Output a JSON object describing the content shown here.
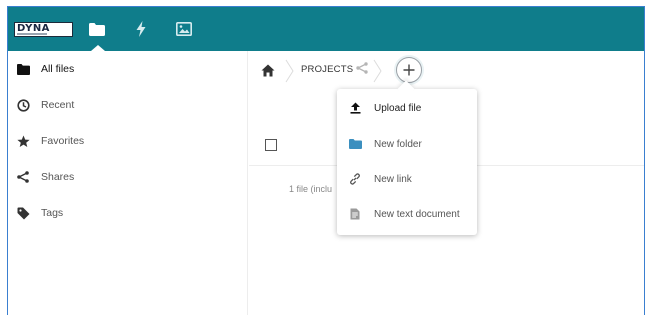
{
  "header": {
    "logo_text": "DYNA",
    "apps": [
      {
        "name": "files",
        "icon": "folder-icon",
        "active": true
      },
      {
        "name": "activity",
        "icon": "lightning-icon",
        "active": false
      },
      {
        "name": "gallery",
        "icon": "image-icon",
        "active": false
      }
    ],
    "bar_color": "#0f7d8b"
  },
  "sidebar": {
    "items": [
      {
        "label": "All files",
        "icon": "folder-icon",
        "active": true
      },
      {
        "label": "Recent",
        "icon": "clock-icon",
        "active": false
      },
      {
        "label": "Favorites",
        "icon": "star-icon",
        "active": false
      },
      {
        "label": "Shares",
        "icon": "share-icon",
        "active": false
      },
      {
        "label": "Tags",
        "icon": "tag-icon",
        "active": false
      }
    ]
  },
  "breadcrumb": {
    "home_icon": "home-icon",
    "current": "PROJECTS",
    "share_icon": "share-icon",
    "add_icon": "plus-icon"
  },
  "file_list": {
    "summary": "1 file (inclu"
  },
  "new_menu": {
    "items": [
      {
        "label": "Upload file",
        "icon": "upload-icon"
      },
      {
        "label": "New folder",
        "icon": "folder-icon",
        "icon_color": "#3b8fbf"
      },
      {
        "label": "New link",
        "icon": "link-icon"
      },
      {
        "label": "New text document",
        "icon": "text-document-icon"
      }
    ]
  }
}
